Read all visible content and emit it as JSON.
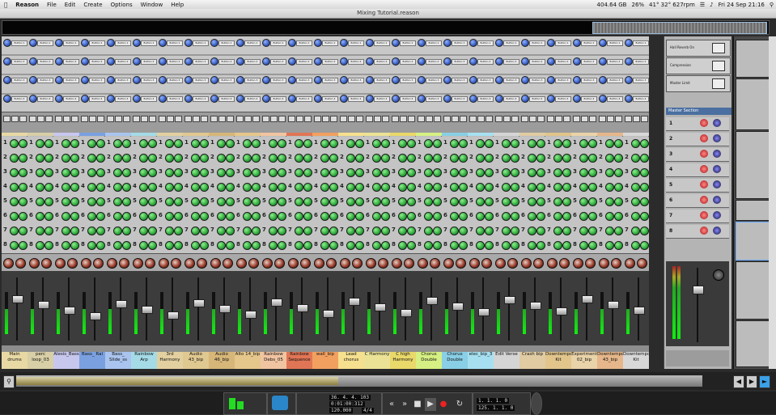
{
  "menubar": {
    "app": "Reason",
    "menus": [
      "File",
      "Edit",
      "Create",
      "Options",
      "Window",
      "Help"
    ],
    "status": [
      "404.64 GB",
      "26%",
      "41° 32° 627rpm",
      "Fri 24 Sep  21:16"
    ]
  },
  "window": {
    "title": "Mixing Tutorial.reason"
  },
  "channels": [
    {
      "name": "Main drums",
      "color": "#e8d9a4"
    },
    {
      "name": "perc loop_03",
      "color": "#d8cfa7"
    },
    {
      "name": "Alesis_Bass",
      "color": "#c7c7ee"
    },
    {
      "name": "Bass_ Ral",
      "color": "#7aa0e0"
    },
    {
      "name": "Bass_ Slide_ss",
      "color": "#a9c4ee"
    },
    {
      "name": "Rainbow Arp",
      "color": "#a4dbe6"
    },
    {
      "name": "3rd Harmony",
      "color": "#e3d0a0"
    },
    {
      "name": "Audio 43_bip",
      "color": "#e0c891"
    },
    {
      "name": "Audio 46_bip",
      "color": "#d7b779"
    },
    {
      "name": "Alto 14_bip",
      "color": "#e6c78b"
    },
    {
      "name": "Rainbow Debs_05",
      "color": "#f1c4a1"
    },
    {
      "name": "Rainbow Sequence",
      "color": "#e07555"
    },
    {
      "name": "wall_bip",
      "color": "#f2a060"
    },
    {
      "name": "Lead chorus",
      "color": "#f5e08f"
    },
    {
      "name": "C Harmony",
      "color": "#ebe296"
    },
    {
      "name": "C high Harmony",
      "color": "#e9d86a"
    },
    {
      "name": "Chorus Double",
      "color": "#d6f083"
    },
    {
      "name": "Chorus Double",
      "color": "#89cfe6"
    },
    {
      "name": "elec_bip_3",
      "color": "#a6e0f0"
    },
    {
      "name": "Edit Verse",
      "color": "#d5d5d5"
    },
    {
      "name": "Crash bip",
      "color": "#e0cba3"
    },
    {
      "name": "Downtempo Kit",
      "color": "#e1c58b"
    },
    {
      "name": "Experiment 02_bip",
      "color": "#e9d3a8"
    },
    {
      "name": "Downtempo 43_bip",
      "color": "#e6b78a"
    },
    {
      "name": "Downtempo Kit",
      "color": "#d8d8d8"
    }
  ],
  "sends": [
    "Button 1",
    "Button 2",
    "Button 3",
    "Button 4"
  ],
  "master": {
    "fx": [
      "Hall Reverb On",
      "Compression",
      "Master Limit"
    ],
    "title": "Master Section",
    "returns": [
      "1",
      "2",
      "3",
      "4",
      "5",
      "6",
      "7",
      "8"
    ]
  },
  "transport": {
    "position": "36. 4. 4. 103",
    "time": "0:01:00:312",
    "tempo": "120.000",
    "signature": "4/4",
    "loop_left": "1. 1. 1. 0",
    "loop_right": "125. 1. 1. 0"
  }
}
